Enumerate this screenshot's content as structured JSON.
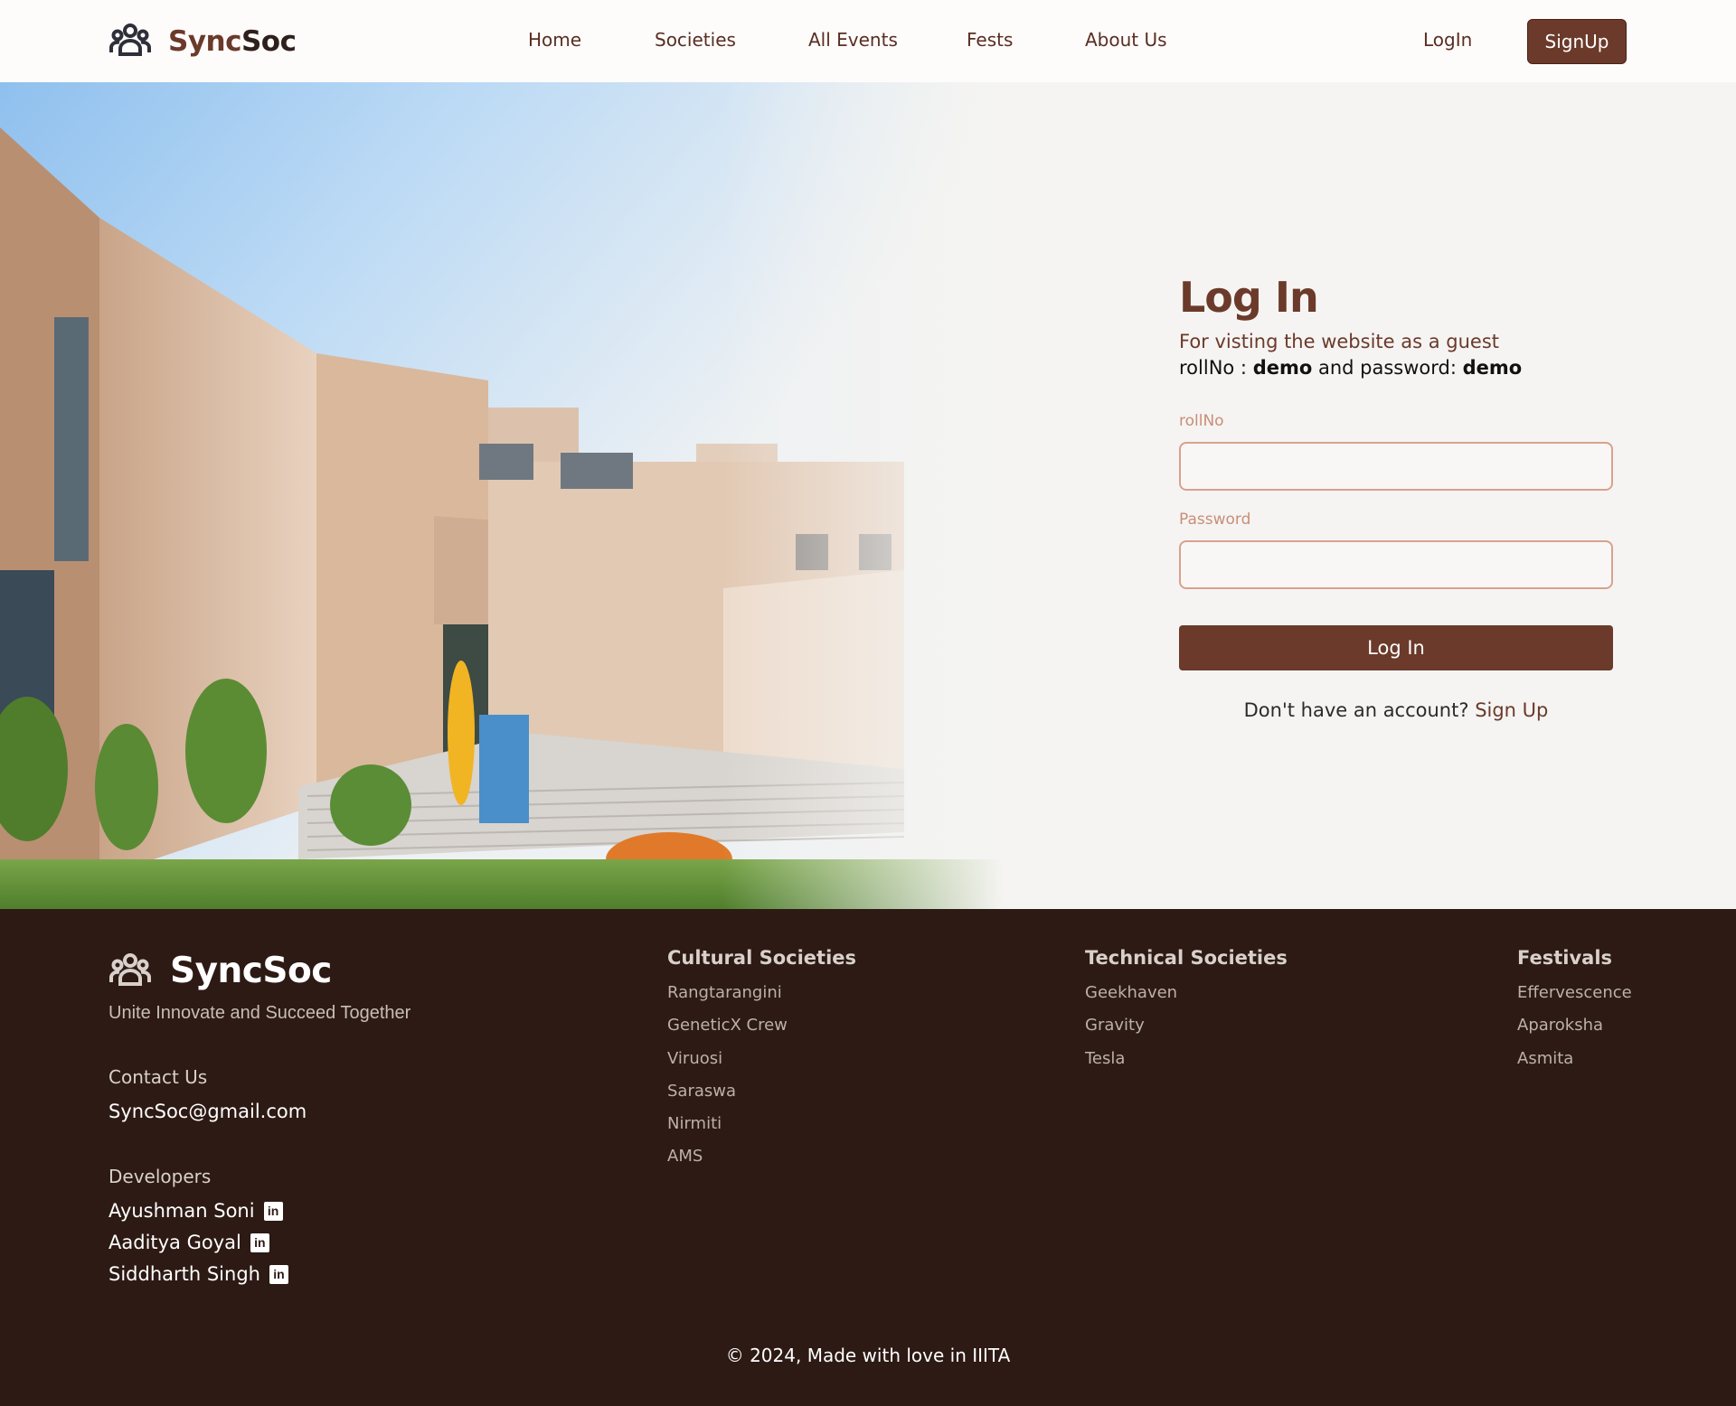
{
  "brand": {
    "part1": "Sync",
    "part2": "Soc",
    "full": "SyncSoc"
  },
  "nav": {
    "home": "Home",
    "societies": "Societies",
    "all_events": "All Events",
    "fests": "Fests",
    "about_us": "About Us",
    "login": "LogIn",
    "signup": "SignUp"
  },
  "login_form": {
    "title": "Log In",
    "guest_info": "For visting the website as a guest",
    "guest_roll_prefix": "rollNo : ",
    "guest_roll_value": "demo",
    "guest_password_prefix": " and password: ",
    "guest_password_value": "demo",
    "rollno_label": "rollNo",
    "rollno_value": "",
    "password_label": "Password",
    "password_value": "",
    "submit_label": "Log In",
    "no_account_text": "Don't have an account? ",
    "signup_link": "Sign Up"
  },
  "footer": {
    "tagline": "Unite Innovate and Succeed Together",
    "contact_heading": "Contact Us",
    "email": "SyncSoc@gmail.com",
    "developers_heading": "Developers",
    "developers": [
      "Ayushman Soni",
      "Aaditya Goyal",
      "Siddharth Singh"
    ],
    "linkedin_glyph": "in",
    "cultural": {
      "title": "Cultural Societies",
      "items": [
        "Rangtarangini",
        "GeneticX Crew",
        "Viruosi",
        "Saraswa",
        "Nirmiti",
        "AMS"
      ]
    },
    "technical": {
      "title": "Technical Societies",
      "items": [
        "Geekhaven",
        "Gravity",
        "Tesla"
      ]
    },
    "festivals": {
      "title": "Festivals",
      "items": [
        "Effervescence",
        "Aparoksha",
        "Asmita"
      ]
    },
    "copyright": "© 2024, Made with love in IIITA"
  },
  "colors": {
    "brand_brown": "#6b3a2a",
    "footer_bg": "#2d1a14",
    "input_border": "#d9a18e",
    "page_bg": "#f5f4f2"
  },
  "icons": {
    "logo": "users-group-icon",
    "linkedin": "linkedin-icon"
  }
}
